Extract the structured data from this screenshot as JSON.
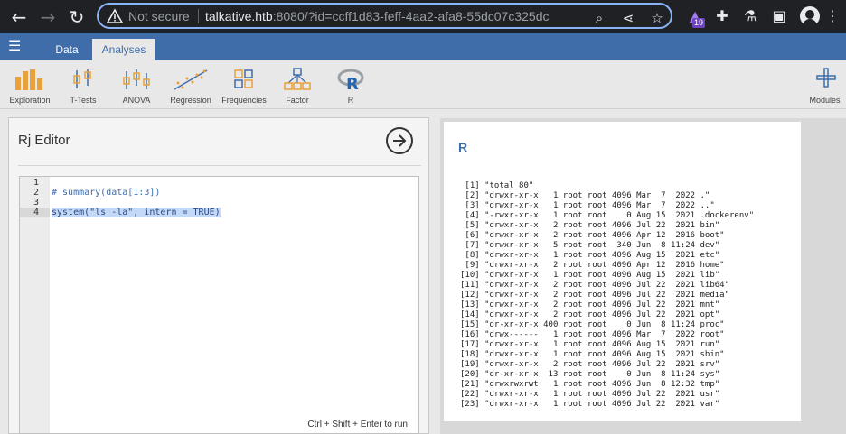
{
  "browser": {
    "not_secure": "Not secure",
    "url_host": "talkative.htb",
    "url_rest": ":8080/?id=ccff1d83-feff-4aa2-afa8-55dc07c325dc",
    "extension_badge": "19"
  },
  "tabs": [
    "Data",
    "Analyses"
  ],
  "ribbon": {
    "exploration": "Exploration",
    "ttests": "T-Tests",
    "anova": "ANOVA",
    "regression": "Regression",
    "frequencies": "Frequencies",
    "factor": "Factor",
    "r": "R",
    "modules": "Modules"
  },
  "editor": {
    "title": "Rj Editor",
    "line_numbers": [
      "1",
      "2",
      "3",
      "4"
    ],
    "code_line2": "# summary(data[1:3])",
    "code_line4": "system(\"ls -la\", intern = TRUE)",
    "run_hint": "Ctrl + Shift + Enter to run"
  },
  "results": {
    "heading": "R",
    "output": [
      " [1] \"total 80\"",
      " [2] \"drwxr-xr-x   1 root root 4096 Mar  7  2022 .\"",
      " [3] \"drwxr-xr-x   1 root root 4096 Mar  7  2022 ..\"",
      " [4] \"-rwxr-xr-x   1 root root    0 Aug 15  2021 .dockerenv\"",
      " [5] \"drwxr-xr-x   2 root root 4096 Jul 22  2021 bin\"",
      " [6] \"drwxr-xr-x   2 root root 4096 Apr 12  2016 boot\"",
      " [7] \"drwxr-xr-x   5 root root  340 Jun  8 11:24 dev\"",
      " [8] \"drwxr-xr-x   1 root root 4096 Aug 15  2021 etc\"",
      " [9] \"drwxr-xr-x   2 root root 4096 Apr 12  2016 home\"",
      "[10] \"drwxr-xr-x   1 root root 4096 Aug 15  2021 lib\"",
      "[11] \"drwxr-xr-x   2 root root 4096 Jul 22  2021 lib64\"",
      "[12] \"drwxr-xr-x   2 root root 4096 Jul 22  2021 media\"",
      "[13] \"drwxr-xr-x   2 root root 4096 Jul 22  2021 mnt\"",
      "[14] \"drwxr-xr-x   2 root root 4096 Jul 22  2021 opt\"",
      "[15] \"dr-xr-xr-x 400 root root    0 Jun  8 11:24 proc\"",
      "[16] \"drwx------   1 root root 4096 Mar  7  2022 root\"",
      "[17] \"drwxr-xr-x   1 root root 4096 Aug 15  2021 run\"",
      "[18] \"drwxr-xr-x   1 root root 4096 Aug 15  2021 sbin\"",
      "[19] \"drwxr-xr-x   2 root root 4096 Jul 22  2021 srv\"",
      "[20] \"dr-xr-xr-x  13 root root    0 Jun  8 11:24 sys\"",
      "[21] \"drwxrwxrwt   1 root root 4096 Jun  8 12:32 tmp\"",
      "[22] \"drwxr-xr-x   1 root root 4096 Jul 22  2021 usr\"",
      "[23] \"drwxr-xr-x   1 root root 4096 Jul 22  2021 var\""
    ]
  }
}
